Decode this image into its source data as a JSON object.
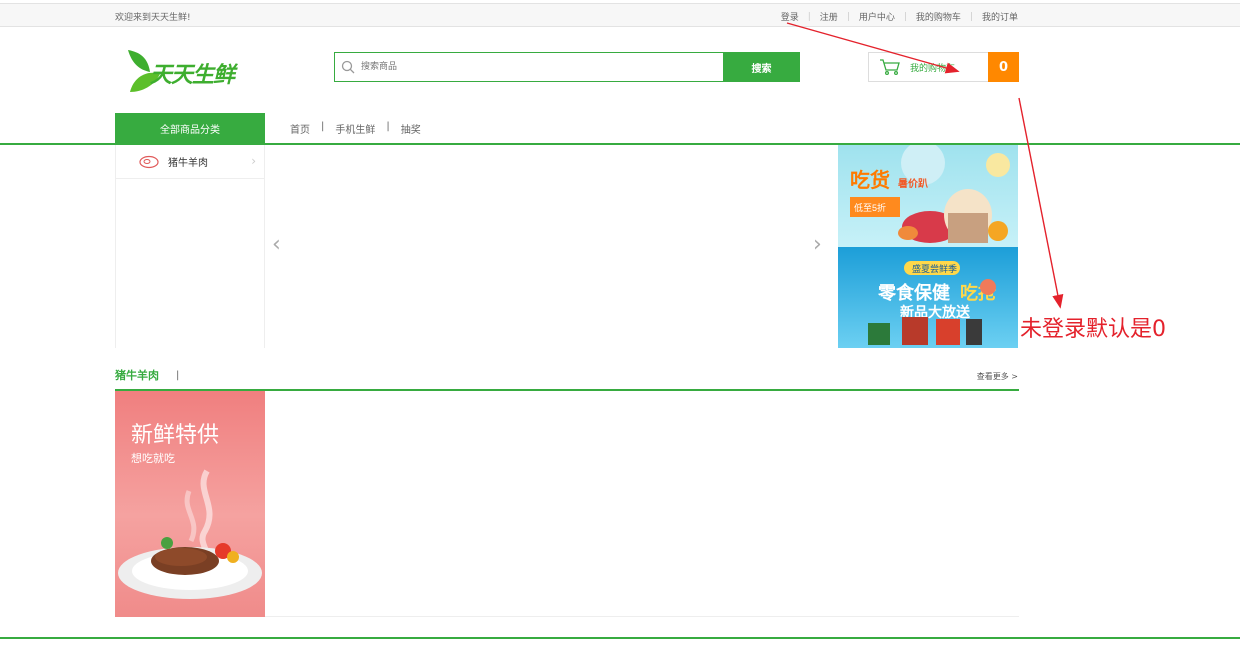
{
  "topbar": {
    "welcome": "欢迎来到天天生鲜!",
    "links": [
      "登录",
      "注册",
      "用户中心",
      "我的购物车",
      "我的订单"
    ]
  },
  "header": {
    "logo_text": "天天生鲜",
    "search": {
      "placeholder": "搜索商品",
      "button": "搜索"
    },
    "cart": {
      "label": "我的购物车",
      "count": "0"
    }
  },
  "nav": {
    "all_categories": "全部商品分类",
    "items": [
      "首页",
      "手机生鲜",
      "抽奖"
    ]
  },
  "category_menu": [
    {
      "label": "猪牛羊肉",
      "icon": "meat-icon"
    }
  ],
  "annotation": {
    "text": "未登录默认是0",
    "color": "#e4222c"
  },
  "section": {
    "title": "猪牛羊肉",
    "separator": "|",
    "more": "查看更多 >",
    "banner_title": "新鲜特供",
    "banner_subtitle": "想吃就吃"
  },
  "colors": {
    "brand_green": "#37ab40",
    "cart_orange": "#ff8800",
    "annotation_red": "#e4222c"
  }
}
